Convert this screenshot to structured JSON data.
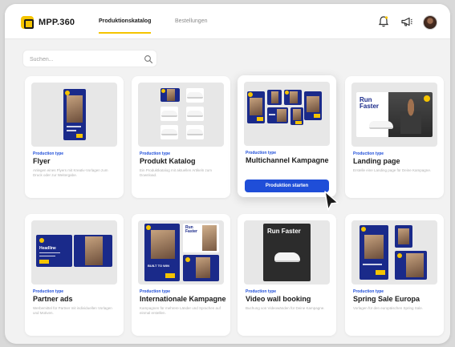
{
  "app": {
    "logo_text": "MPP.360"
  },
  "nav": {
    "tabs": [
      {
        "label": "Produktionskatalog"
      },
      {
        "label": "Bestellungen"
      }
    ]
  },
  "search": {
    "placeholder": "Suchen..."
  },
  "colors": {
    "accent": "#f5c400",
    "primary": "#1f4ed8",
    "ad_navy": "#1a2a8a"
  },
  "icons": [
    "bell-icon",
    "megaphone-icon",
    "search-icon",
    "cursor-icon"
  ],
  "cards": [
    {
      "type": "Production type",
      "title": "Flyer",
      "desc": "Anlegen eines Flyers mit Kreativ-Vorlagen zum Druck oder zur Weitergabe."
    },
    {
      "type": "Production type",
      "title": "Produkt Katalog",
      "desc": "Ein Produktkatalog mit aktuellen Artikeln zum Download."
    },
    {
      "type": "Production type",
      "title": "Multichannel Kampagne",
      "button": "Produktion starten"
    },
    {
      "type": "Production type",
      "title": "Landing page",
      "desc": "Erstelle eine Landing page für Deine Kampagne."
    },
    {
      "type": "Production type",
      "title": "Partner ads",
      "desc": "Werbemittel für Partner mit individuellen Vorlagen und Motiven."
    },
    {
      "type": "Production type",
      "title": "Internationale Kampagne",
      "desc": "Kampagnen für mehrere Länder und Sprachen auf einmal erstellen."
    },
    {
      "type": "Production type",
      "title": "Video wall booking",
      "desc": "Buchung von Videowänden für Deine Kampagne."
    },
    {
      "type": "Production type",
      "title": "Spring Sale Europa",
      "desc": "Vorlagen für den europäischen Spring Sale."
    }
  ],
  "thumb_text": {
    "run_faster": "Run Faster",
    "headline": "Headline",
    "new_price": "BUILT TO WIN"
  }
}
